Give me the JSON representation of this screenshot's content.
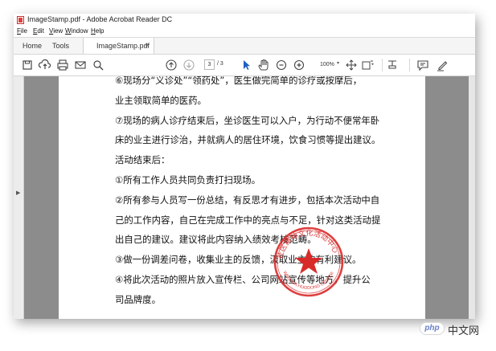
{
  "window": {
    "title": "ImageStamp.pdf - Adobe Acrobat Reader DC"
  },
  "menu": [
    "File",
    "Edit",
    "View",
    "Window",
    "Help"
  ],
  "tabs": {
    "home": "Home",
    "tools": "Tools",
    "document": "ImageStamp.pdf",
    "close": "×"
  },
  "toolbar": {
    "page_current": "3",
    "page_total": "/ 3",
    "zoom": "100%",
    "icons": [
      "save-icon",
      "upload-icon",
      "print-icon",
      "email-icon",
      "search-icon",
      "page-up-icon",
      "page-down-icon",
      "select-cursor-icon",
      "hand-icon",
      "zoom-out-icon",
      "zoom-in-icon",
      "fit-page-icon",
      "rotate-icon",
      "comment-icon",
      "pen-icon"
    ]
  },
  "document": {
    "lines": [
      "⑥现场分“义诊处”“领药处”，医生做完简单的诊疗或按摩后，",
      "业主领取简单的医药。",
      "⑦现场的病人诊疗结束后，坐诊医生可以入户，为行动不便常年卧",
      "床的业主进行诊治，并就病人的居住环境，饮食习惯等提出建议。",
      "活动结束后：",
      "①所有工作人员共同负责打扫现场。",
      "②所有参与人员写一份总结，有反思才有进步，包括本次活动中自",
      "己的工作内容，自己在完成工作中的亮点与不足，针对这类活动提",
      "出自己的建议。建议将此内容纳入绩效考核范畴。",
      "③做一份调差问卷，收集业主的反馈，汲取业主的有利建议。",
      "④将此次活动的照片放入宣传栏、公司网站宣传等地方，提升公",
      "司品牌度。"
    ],
    "stamp": {
      "text_top": "社区精神文化活动中心",
      "text_bottom": "WENHUA HUODONG CENTER",
      "color": "#d92a2a"
    }
  },
  "watermark": {
    "logo": "php",
    "site": "中文网"
  }
}
